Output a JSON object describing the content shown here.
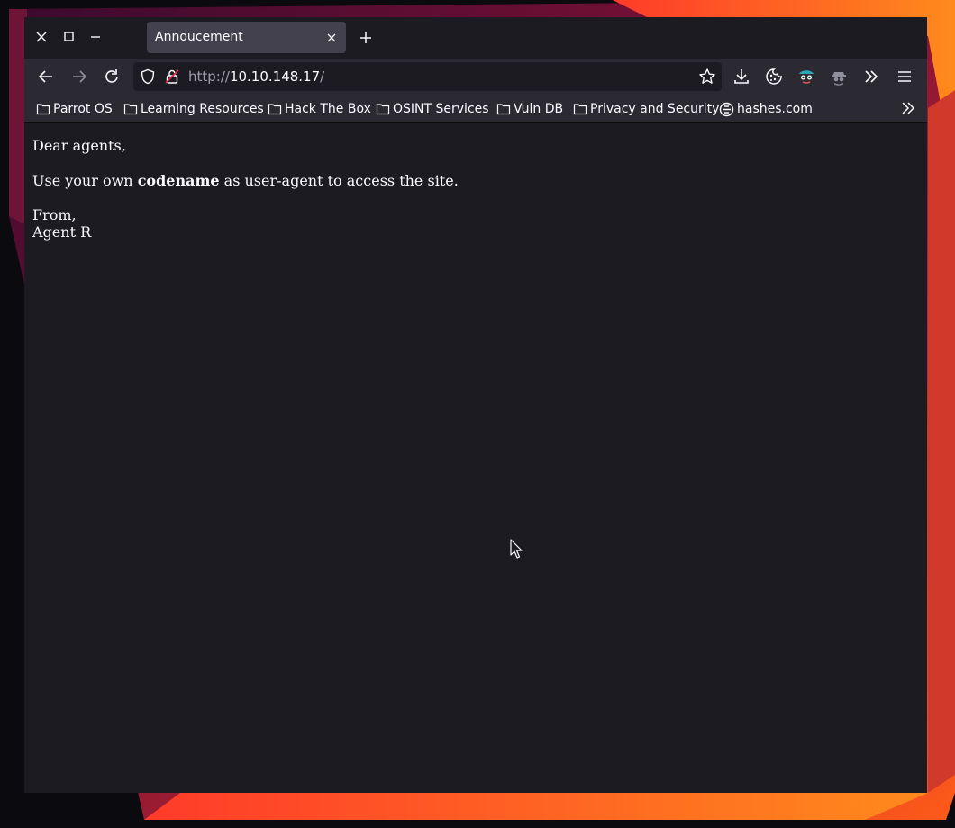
{
  "window": {
    "controls": {
      "close": "close-icon",
      "maximize": "maximize-icon",
      "minimize": "minimize-icon"
    }
  },
  "tab": {
    "title": "Annoucement"
  },
  "navigation": {
    "url_protocol": "http://",
    "url_host": "10.10.148.17",
    "url_path": "/"
  },
  "bookmarks": [
    {
      "label": "Parrot OS",
      "icon": "folder-icon"
    },
    {
      "label": "Learning Resources",
      "icon": "folder-icon"
    },
    {
      "label": "Hack The Box",
      "icon": "folder-icon"
    },
    {
      "label": "OSINT Services",
      "icon": "folder-icon"
    },
    {
      "label": "Vuln DB",
      "icon": "folder-icon"
    },
    {
      "label": "Privacy and Security",
      "icon": "folder-icon"
    },
    {
      "label": "hashes.com",
      "icon": "hashes-logo-icon"
    }
  ],
  "page": {
    "greeting": "Dear agents,",
    "line_before": "Use your own ",
    "line_bold": "codename",
    "line_after": " as user-agent to access the site.",
    "from": "From,",
    "signature": "Agent R"
  },
  "colors": {
    "toolbar": "#2b2a33",
    "page_background": "#1c1b22",
    "tab_active": "#42414d",
    "text": "#fbfbfe"
  }
}
